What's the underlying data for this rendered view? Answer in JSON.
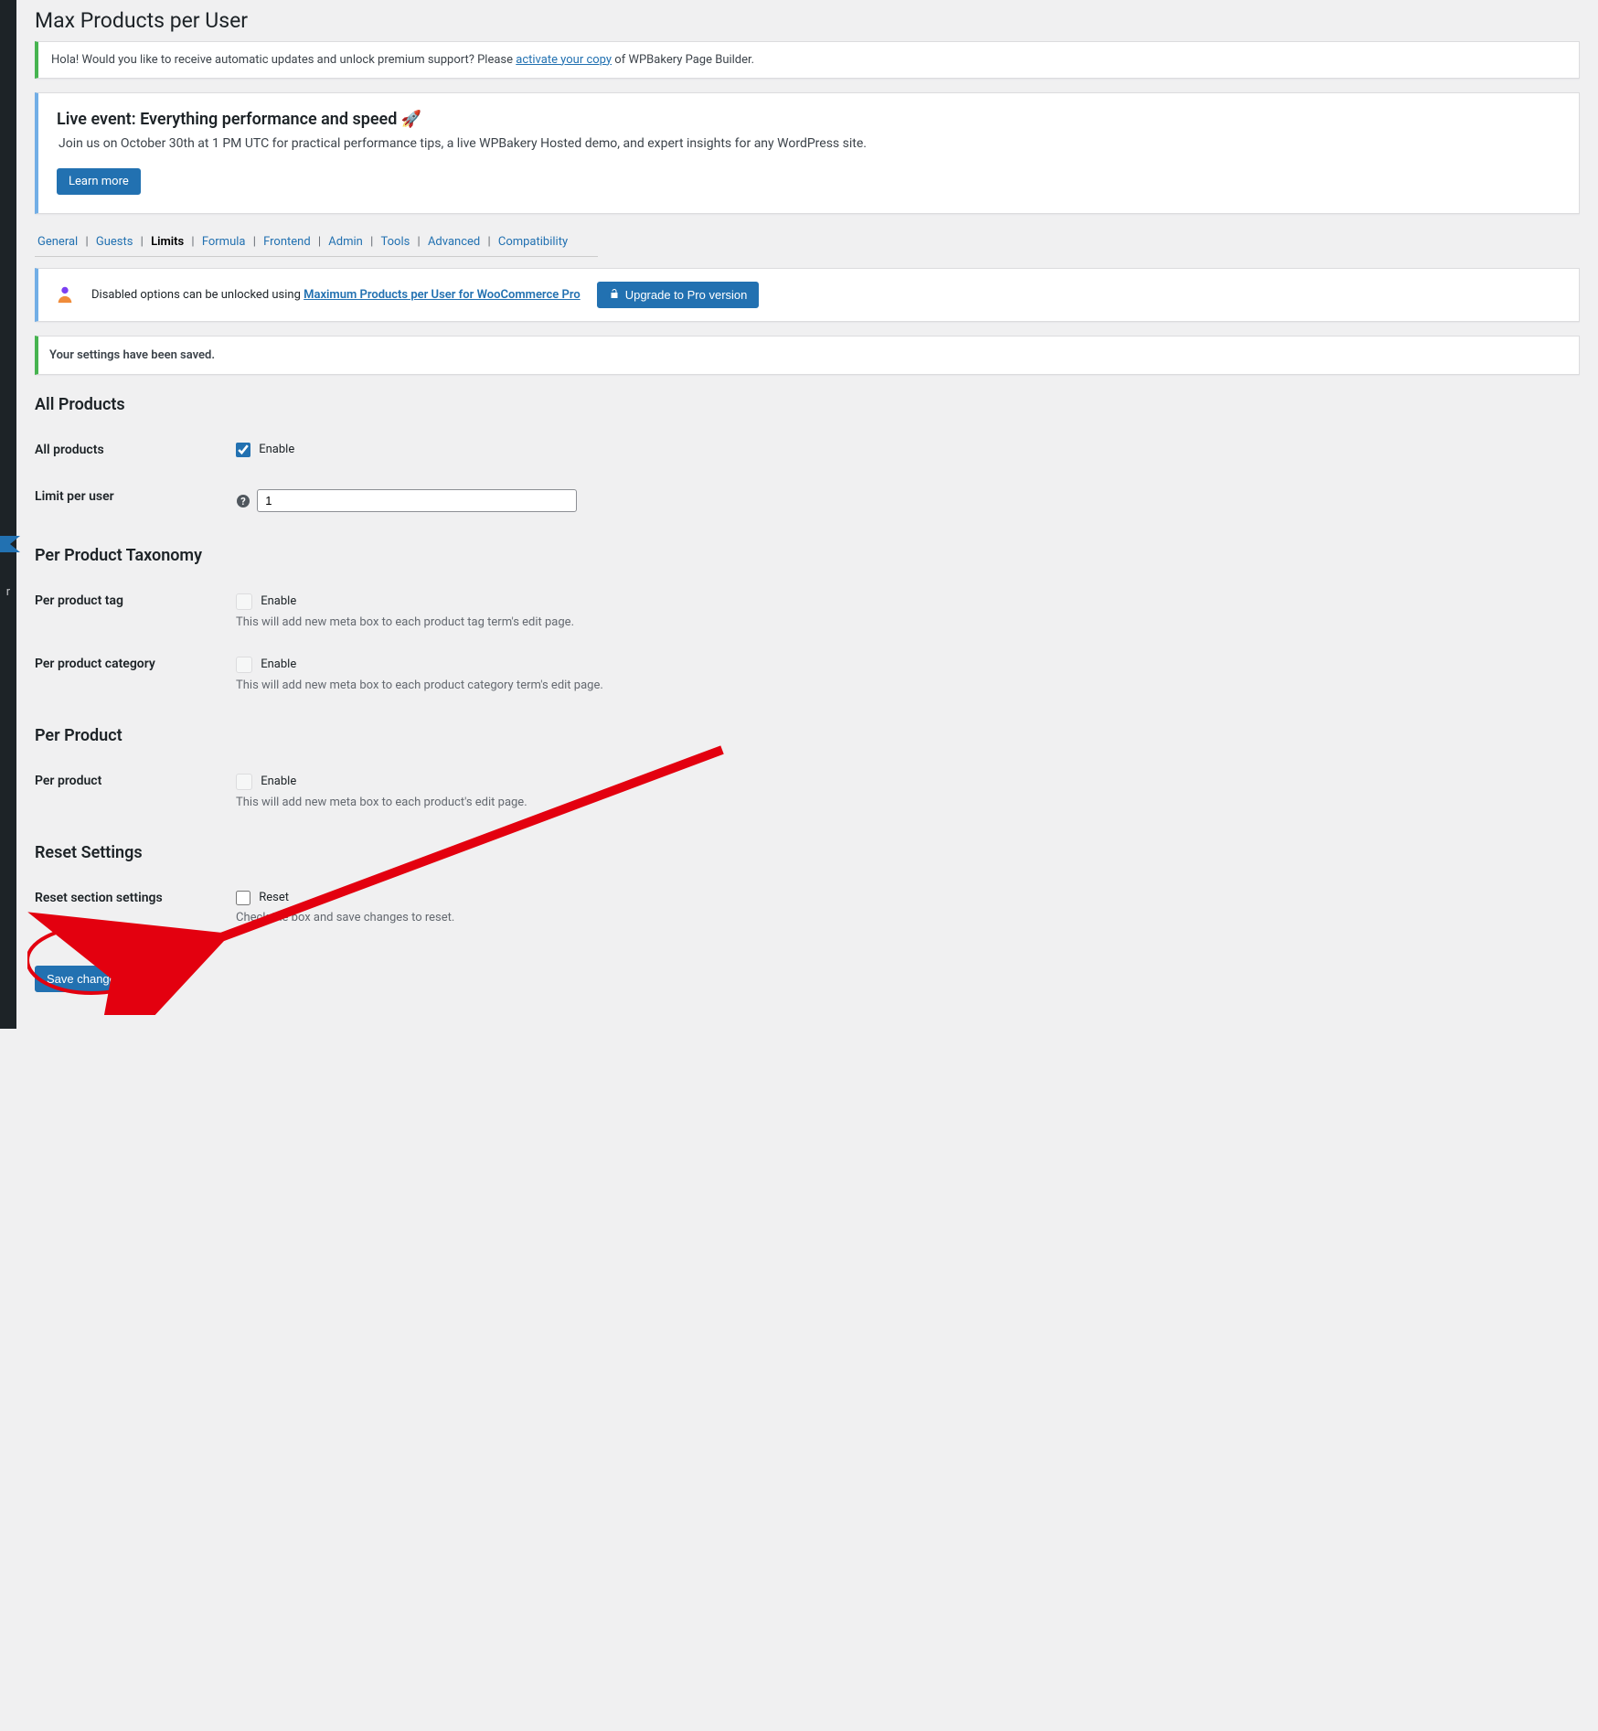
{
  "page": {
    "title": "Max Products per User"
  },
  "notices": {
    "activate": {
      "pre": "Hola! Would you like to receive automatic updates and unlock premium support? Please ",
      "link": "activate your copy",
      "post": " of WPBakery Page Builder."
    },
    "event": {
      "title": "Live event: Everything performance and speed ",
      "body": "Join us on October 30th at 1 PM UTC for practical performance tips, a live WPBakery Hosted demo, and expert insights for any WordPress site.",
      "button": "Learn more"
    },
    "pro": {
      "text_pre": "Disabled options can be unlocked using ",
      "link": "Maximum Products per User for WooCommerce Pro",
      "button": "Upgrade to Pro version"
    },
    "saved": "Your settings have been saved."
  },
  "tabs": {
    "general": "General",
    "guests": "Guests",
    "limits": "Limits",
    "formula": "Formula",
    "frontend": "Frontend",
    "admin": "Admin",
    "tools": "Tools",
    "advanced": "Advanced",
    "compatibility": "Compatibility"
  },
  "sections": {
    "all_products": {
      "heading": "All Products",
      "row_allproducts": {
        "label": "All products",
        "enable": "Enable",
        "checked": true
      },
      "row_limit": {
        "label": "Limit per user",
        "value": "1"
      }
    },
    "per_taxonomy": {
      "heading": "Per Product Taxonomy",
      "row_tag": {
        "label": "Per product tag",
        "enable": "Enable",
        "desc": "This will add new meta box to each product tag term's edit page."
      },
      "row_cat": {
        "label": "Per product category",
        "enable": "Enable",
        "desc": "This will add new meta box to each product category term's edit page."
      }
    },
    "per_product": {
      "heading": "Per Product",
      "row": {
        "label": "Per product",
        "enable": "Enable",
        "desc": "This will add new meta box to each product's edit page."
      }
    },
    "reset": {
      "heading": "Reset Settings",
      "row": {
        "label": "Reset section settings",
        "reset": "Reset",
        "desc": "Check the box and save changes to reset."
      }
    }
  },
  "submit": {
    "label": "Save changes"
  },
  "sidebar": {
    "menu_letter": "r"
  }
}
